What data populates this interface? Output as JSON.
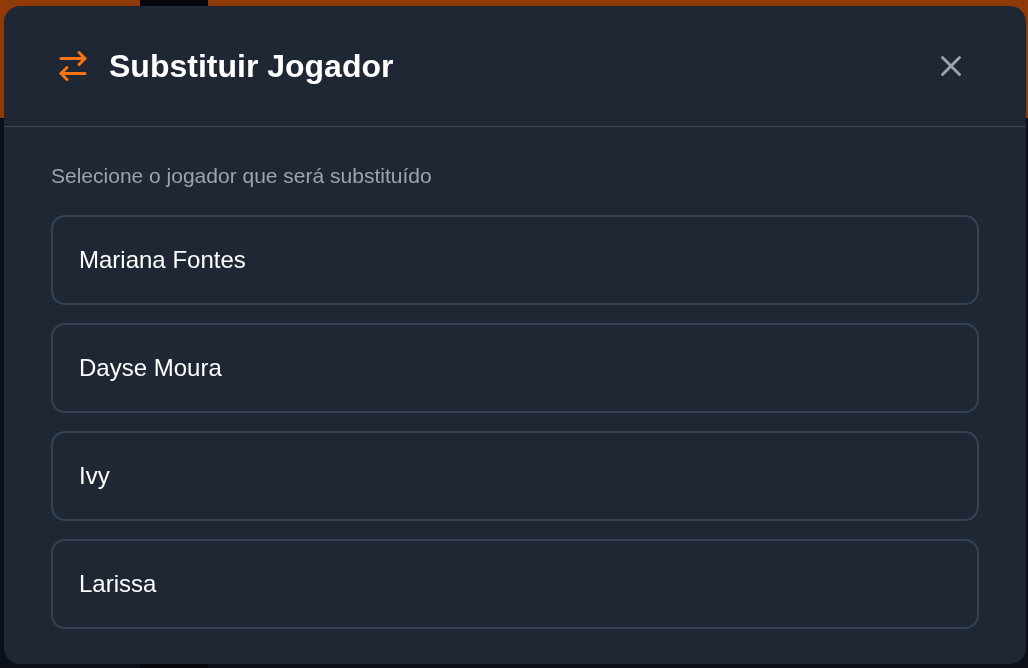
{
  "dialog": {
    "title": "Substituir Jogador",
    "subtitle": "Selecione o jogador que será substituído",
    "players": [
      {
        "name": "Mariana Fontes"
      },
      {
        "name": "Dayse Moura"
      },
      {
        "name": "Ivy"
      },
      {
        "name": "Larissa"
      }
    ]
  }
}
